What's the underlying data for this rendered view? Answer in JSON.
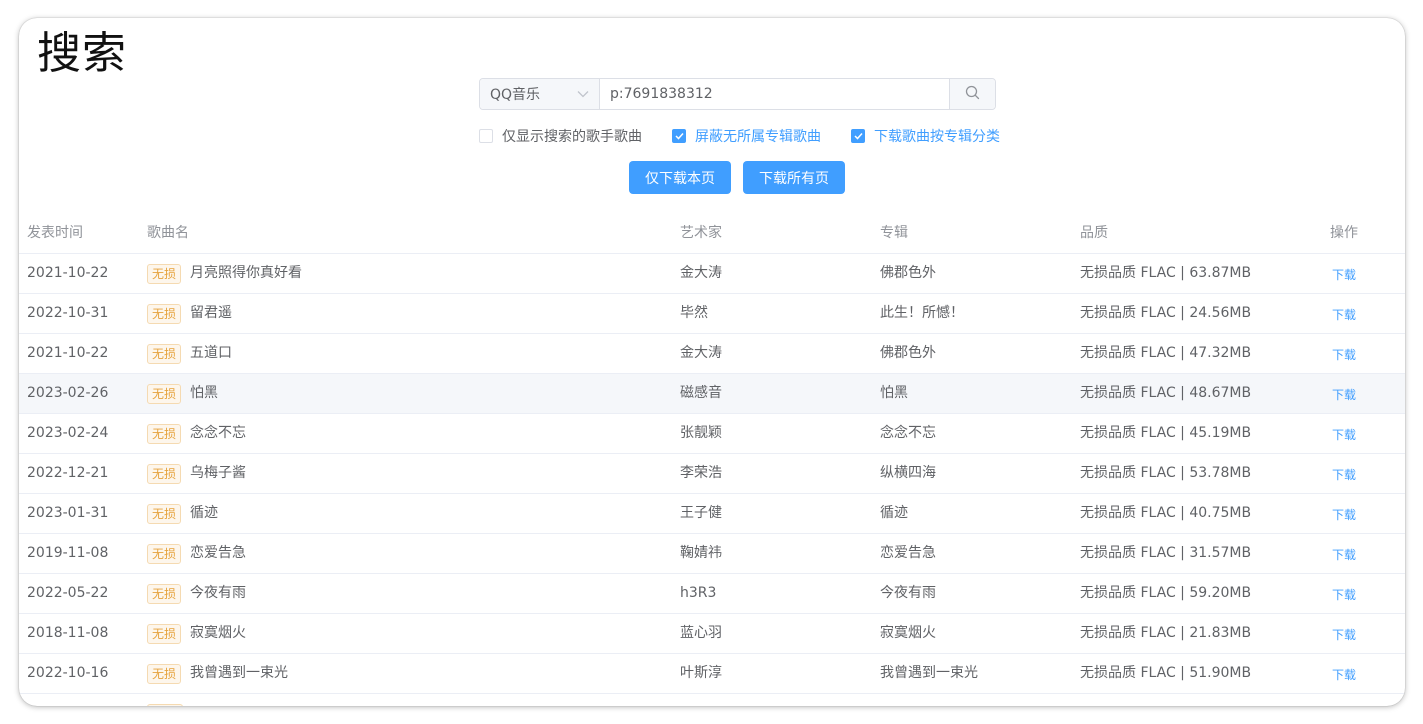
{
  "page": {
    "title": "搜索"
  },
  "search": {
    "source_selected": "QQ音乐",
    "query_value": "p:7691838312",
    "placeholder": ""
  },
  "options": [
    {
      "label": "仅显示搜索的歌手歌曲",
      "checked": false
    },
    {
      "label": "屏蔽无所属专辑歌曲",
      "checked": true
    },
    {
      "label": "下载歌曲按专辑分类",
      "checked": true
    }
  ],
  "buttons": {
    "download_page": "仅下载本页",
    "download_all": "下载所有页"
  },
  "table": {
    "headers": {
      "date": "发表时间",
      "song": "歌曲名",
      "artist": "艺术家",
      "album": "专辑",
      "quality": "品质",
      "op": "操作"
    },
    "lossless_tag": "无损",
    "download_link": "下载",
    "rows": [
      {
        "date": "2021-10-22",
        "song": "月亮照得你真好看",
        "artist": "金大涛",
        "album": "佛郡色外",
        "quality": "无损品质 FLAC | 63.87MB"
      },
      {
        "date": "2022-10-31",
        "song": "留君遥",
        "artist": "毕然",
        "album": "此生！所憾！",
        "quality": "无损品质 FLAC | 24.56MB"
      },
      {
        "date": "2021-10-22",
        "song": "五道口",
        "artist": "金大涛",
        "album": "佛郡色外",
        "quality": "无损品质 FLAC | 47.32MB"
      },
      {
        "date": "2023-02-26",
        "song": "怕黑",
        "artist": "磁感音",
        "album": "怕黑",
        "quality": "无损品质 FLAC | 48.67MB"
      },
      {
        "date": "2023-02-24",
        "song": "念念不忘",
        "artist": "张靓颖",
        "album": "念念不忘",
        "quality": "无损品质 FLAC | 45.19MB"
      },
      {
        "date": "2022-12-21",
        "song": "乌梅子酱",
        "artist": "李荣浩",
        "album": "纵横四海",
        "quality": "无损品质 FLAC | 53.78MB"
      },
      {
        "date": "2023-01-31",
        "song": "循迹",
        "artist": "王子健",
        "album": "循迹",
        "quality": "无损品质 FLAC | 40.75MB"
      },
      {
        "date": "2019-11-08",
        "song": "恋爱告急",
        "artist": "鞠婧祎",
        "album": "恋爱告急",
        "quality": "无损品质 FLAC | 31.57MB"
      },
      {
        "date": "2022-05-22",
        "song": "今夜有雨",
        "artist": "h3R3",
        "album": "今夜有雨",
        "quality": "无损品质 FLAC | 59.20MB"
      },
      {
        "date": "2018-11-08",
        "song": "寂寞烟火",
        "artist": "蓝心羽",
        "album": "寂寞烟火",
        "quality": "无损品质 FLAC | 21.83MB"
      },
      {
        "date": "2022-10-16",
        "song": "我曾遇到一束光",
        "artist": "叶斯淳",
        "album": "我曾遇到一束光",
        "quality": "无损品质 FLAC | 51.90MB"
      }
    ]
  },
  "icons": {
    "dropdown": "chevron-down-icon",
    "search": "search-icon",
    "check": "check-icon"
  },
  "colors": {
    "primary": "#409eff",
    "tag_text": "#e6a23c",
    "tag_bg": "#fdf6ec"
  }
}
